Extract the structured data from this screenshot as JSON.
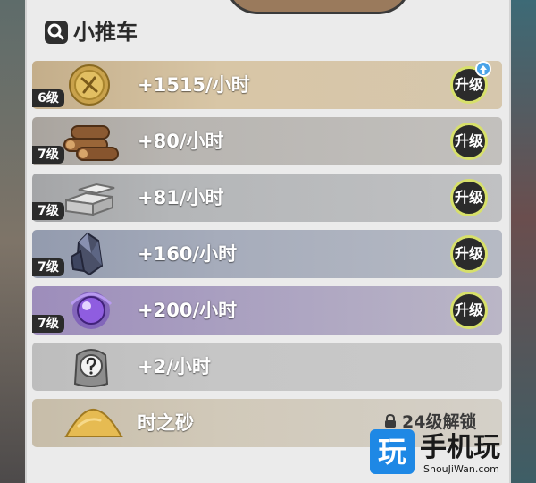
{
  "header": {
    "title": "小推车",
    "icon": "search-icon"
  },
  "upgrade_label": "升级",
  "rows": [
    {
      "icon": "gold-coin-icon",
      "level": "6级",
      "rate": "+1515/小时",
      "has_upgrade_button": true,
      "upgrade_available": true
    },
    {
      "icon": "wood-logs-icon",
      "level": "7级",
      "rate": "+80/小时",
      "has_upgrade_button": true
    },
    {
      "icon": "stone-bricks-icon",
      "level": "7级",
      "rate": "+81/小时",
      "has_upgrade_button": true
    },
    {
      "icon": "crystal-ore-icon",
      "level": "7级",
      "rate": "+160/小时",
      "has_upgrade_button": true
    },
    {
      "icon": "purple-orb-icon",
      "level": "7级",
      "rate": "+200/小时",
      "has_upgrade_button": true
    },
    {
      "icon": "mystery-item-icon",
      "rate": "+2/小时"
    },
    {
      "icon": "sand-pile-icon",
      "rate": "时之砂",
      "locked": true,
      "lock_text": "24级解锁"
    }
  ],
  "colors": {
    "panel_bg": "#ebebeb",
    "upgrade_ring": "#d7e06a",
    "upgrade_available_badge": "#4aa3e8",
    "badge_bg": "#2b2b2b"
  },
  "watermark": {
    "glyph": "玩",
    "main": "手机玩",
    "sub": "ShouJiWan.com"
  }
}
